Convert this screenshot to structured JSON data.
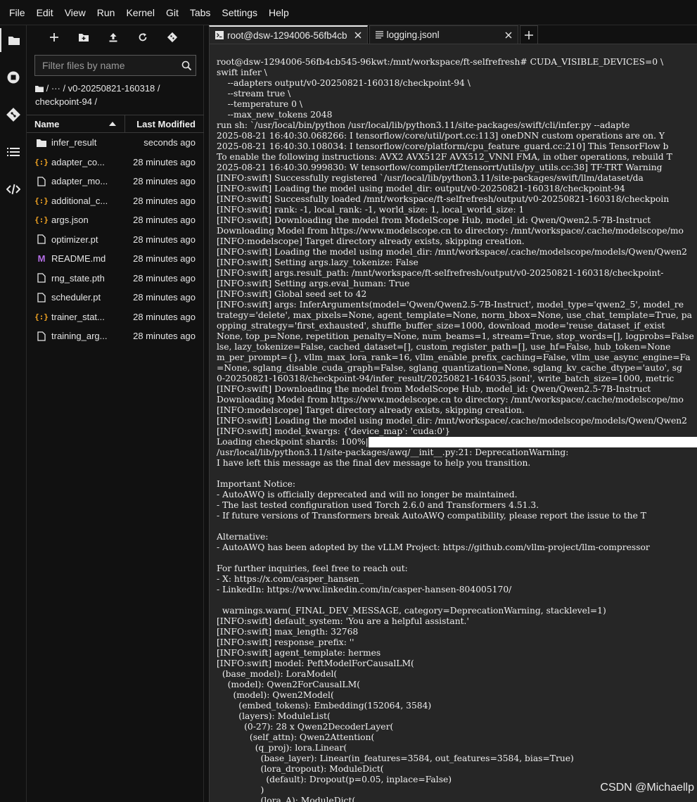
{
  "menubar": {
    "items": [
      "File",
      "Edit",
      "View",
      "Run",
      "Kernel",
      "Git",
      "Tabs",
      "Settings",
      "Help"
    ]
  },
  "activity": {
    "items": [
      "folder-icon",
      "running-icon",
      "git-icon",
      "toc-icon",
      "extension-icon"
    ]
  },
  "filebrowser": {
    "toolbar": [
      "new-launcher-icon",
      "new-folder-icon",
      "upload-icon",
      "refresh-icon",
      "git-clone-icon"
    ],
    "filter_placeholder": "Filter files by name",
    "breadcrumb": "/  ···  / v0-20250821-160318 / checkpoint-94 /",
    "header_name": "Name",
    "header_modified": "Last Modified",
    "files": [
      {
        "name": "infer_result",
        "modified": "seconds ago",
        "icon": "folder"
      },
      {
        "name": "adapter_co...",
        "modified": "28 minutes ago",
        "icon": "json"
      },
      {
        "name": "adapter_mo...",
        "modified": "28 minutes ago",
        "icon": "file"
      },
      {
        "name": "additional_c...",
        "modified": "28 minutes ago",
        "icon": "json"
      },
      {
        "name": "args.json",
        "modified": "28 minutes ago",
        "icon": "json"
      },
      {
        "name": "optimizer.pt",
        "modified": "28 minutes ago",
        "icon": "file"
      },
      {
        "name": "README.md",
        "modified": "28 minutes ago",
        "icon": "markdown"
      },
      {
        "name": "rng_state.pth",
        "modified": "28 minutes ago",
        "icon": "file"
      },
      {
        "name": "scheduler.pt",
        "modified": "28 minutes ago",
        "icon": "file"
      },
      {
        "name": "trainer_stat...",
        "modified": "28 minutes ago",
        "icon": "json"
      },
      {
        "name": "training_arg...",
        "modified": "28 minutes ago",
        "icon": "file"
      }
    ]
  },
  "tabs": [
    {
      "label": "root@dsw-1294006-56fb4cb",
      "icon": "terminal",
      "active": true
    },
    {
      "label": "logging.jsonl",
      "icon": "text",
      "active": false
    }
  ],
  "terminal": {
    "lines": [
      "root@dsw-1294006-56fb4cb545-96kwt:/mnt/workspace/ft-selfrefresh# CUDA_VISIBLE_DEVICES=0 \\",
      "swift infer \\",
      "    --adapters output/v0-20250821-160318/checkpoint-94 \\",
      "    --stream true \\",
      "    --temperature 0 \\",
      "    --max_new_tokens 2048",
      "run sh: `/usr/local/bin/python /usr/local/lib/python3.11/site-packages/swift/cli/infer.py --adapte",
      "2025-08-21 16:40:30.068266: I tensorflow/core/util/port.cc:113] oneDNN custom operations are on. Y",
      "2025-08-21 16:40:30.108034: I tensorflow/core/platform/cpu_feature_guard.cc:210] This TensorFlow b",
      "To enable the following instructions: AVX2 AVX512F AVX512_VNNI FMA, in other operations, rebuild T",
      "2025-08-21 16:40:30.999830: W tensorflow/compiler/tf2tensorrt/utils/py_utils.cc:38] TF-TRT Warning",
      "[INFO:swift] Successfully registered `/usr/local/lib/python3.11/site-packages/swift/llm/dataset/da",
      "[INFO:swift] Loading the model using model_dir: output/v0-20250821-160318/checkpoint-94",
      "[INFO:swift] Successfully loaded /mnt/workspace/ft-selfrefresh/output/v0-20250821-160318/checkpoin",
      "[INFO:swift] rank: -1, local_rank: -1, world_size: 1, local_world_size: 1",
      "[INFO:swift] Downloading the model from ModelScope Hub, model_id: Qwen/Qwen2.5-7B-Instruct",
      "Downloading Model from https://www.modelscope.cn to directory: /mnt/workspace/.cache/modelscope/mo",
      "[INFO:modelscope] Target directory already exists, skipping creation.",
      "[INFO:swift] Loading the model using model_dir: /mnt/workspace/.cache/modelscope/models/Qwen/Qwen2",
      "[INFO:swift] Setting args.lazy_tokenize: False",
      "[INFO:swift] args.result_path: /mnt/workspace/ft-selfrefresh/output/v0-20250821-160318/checkpoint-",
      "[INFO:swift] Setting args.eval_human: True",
      "[INFO:swift] Global seed set to 42",
      "[INFO:swift] args: InferArguments(model='Qwen/Qwen2.5-7B-Instruct', model_type='qwen2_5', model_re",
      "trategy='delete', max_pixels=None, agent_template=None, norm_bbox=None, use_chat_template=True, pa",
      "opping_strategy='first_exhausted', shuffle_buffer_size=1000, download_mode='reuse_dataset_if_exist",
      "None, top_p=None, repetition_penalty=None, num_beams=1, stream=True, stop_words=[], logprobs=False",
      "lse, lazy_tokenize=False, cached_dataset=[], custom_register_path=[], use_hf=False, hub_token=None",
      "m_per_prompt={}, vllm_max_lora_rank=16, vllm_enable_prefix_caching=False, vllm_use_async_engine=Fa",
      "=None, sglang_disable_cuda_graph=False, sglang_quantization=None, sglang_kv_cache_dtype='auto', sg",
      "0-20250821-160318/checkpoint-94/infer_result/20250821-164035.jsonl', write_batch_size=1000, metric",
      "[INFO:swift] Downloading the model from ModelScope Hub, model_id: Qwen/Qwen2.5-7B-Instruct",
      "Downloading Model from https://www.modelscope.cn to directory: /mnt/workspace/.cache/modelscope/mo",
      "[INFO:modelscope] Target directory already exists, skipping creation.",
      "[INFO:swift] Loading the model using model_dir: /mnt/workspace/.cache/modelscope/models/Qwen/Qwen2",
      "[INFO:swift] model_kwargs: {'device_map': 'cuda:0'}",
      "Loading checkpoint shards: 100%|",
      "/usr/local/lib/python3.11/site-packages/awq/__init__.py:21: DeprecationWarning:",
      "I have left this message as the final dev message to help you transition.",
      "",
      "Important Notice:",
      "- AutoAWQ is officially deprecated and will no longer be maintained.",
      "- The last tested configuration used Torch 2.6.0 and Transformers 4.51.3.",
      "- If future versions of Transformers break AutoAWQ compatibility, please report the issue to the T",
      "",
      "Alternative:",
      "- AutoAWQ has been adopted by the vLLM Project: https://github.com/vllm-project/llm-compressor",
      "",
      "For further inquiries, feel free to reach out:",
      "- X: https://x.com/casper_hansen_",
      "- LinkedIn: https://www.linkedin.com/in/casper-hansen-804005170/",
      "",
      "  warnings.warn(_FINAL_DEV_MESSAGE, category=DeprecationWarning, stacklevel=1)",
      "[INFO:swift] default_system: 'You are a helpful assistant.'",
      "[INFO:swift] max_length: 32768",
      "[INFO:swift] response_prefix: ''",
      "[INFO:swift] agent_template: hermes",
      "[INFO:swift] model: PeftModelForCausalLM(",
      "  (base_model): LoraModel(",
      "    (model): Qwen2ForCausalLM(",
      "      (model): Qwen2Model(",
      "        (embed_tokens): Embedding(152064, 3584)",
      "        (layers): ModuleList(",
      "          (0-27): 28 x Qwen2DecoderLayer(",
      "            (self_attn): Qwen2Attention(",
      "              (q_proj): lora.Linear(",
      "                (base_layer): Linear(in_features=3584, out_features=3584, bias=True)",
      "                (lora_dropout): ModuleDict(",
      "                  (default): Dropout(p=0.05, inplace=False)",
      "                )",
      "                (lora_A): ModuleDict("
    ],
    "progress_line_index": 36
  },
  "watermark": "CSDN @Michaellp"
}
